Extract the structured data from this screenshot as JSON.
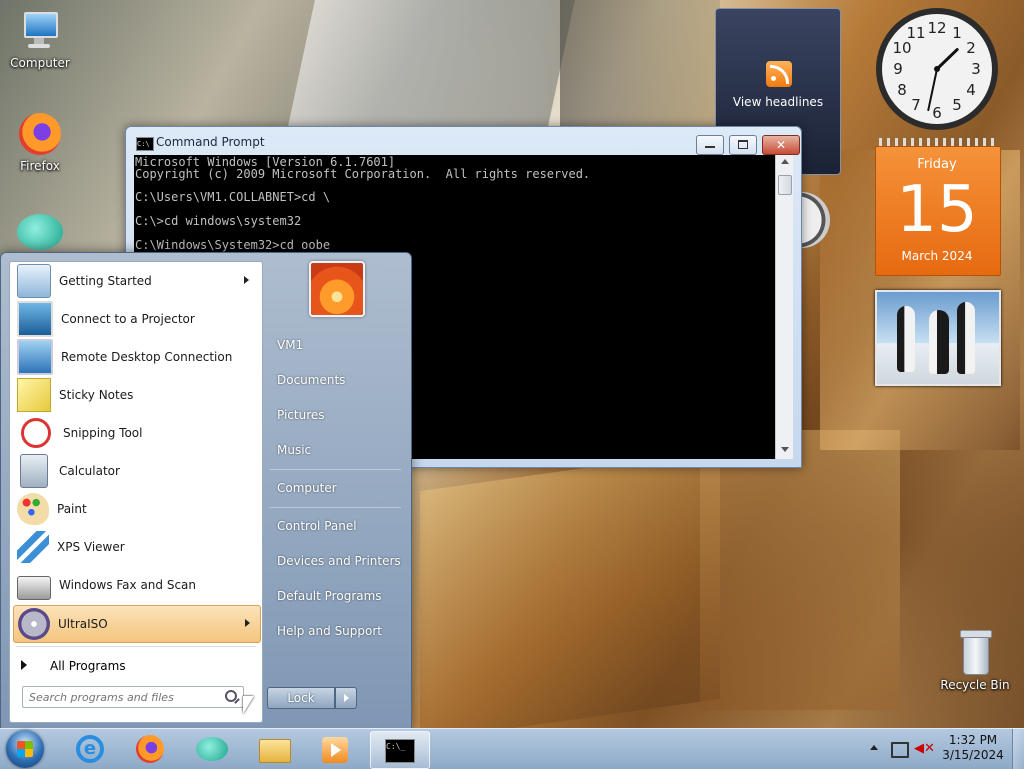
{
  "desktop": {
    "icons": [
      {
        "label": "Computer",
        "icon": "computer-icon"
      },
      {
        "label": "Firefox",
        "icon": "firefox-icon"
      },
      {
        "label": "Recycle Bin",
        "icon": "recycle-bin-icon"
      }
    ]
  },
  "cmd": {
    "title": "Command Prompt",
    "output": "Microsoft Windows [Version 6.1.7601]\nCopyright (c) 2009 Microsoft Corporation.  All rights reserved.\n\nC:\\Users\\VM1.COLLABNET>cd \\\n\nC:\\>cd windows\\system32\n\nC:\\Windows\\System32>cd oobe"
  },
  "gadgets": {
    "headlines": "View headlines",
    "calendar": {
      "weekday": "Friday",
      "day": "15",
      "month_year": "March 2024"
    },
    "clock": {
      "hour": 1,
      "minute": 32
    }
  },
  "start_menu": {
    "programs": [
      {
        "label": "Getting Started",
        "icon": "getting-started-icon",
        "submenu": true
      },
      {
        "label": "Connect to a Projector",
        "icon": "projector-icon"
      },
      {
        "label": "Remote Desktop Connection",
        "icon": "remote-desktop-icon"
      },
      {
        "label": "Sticky Notes",
        "icon": "sticky-notes-icon"
      },
      {
        "label": "Snipping Tool",
        "icon": "snipping-tool-icon"
      },
      {
        "label": "Calculator",
        "icon": "calculator-icon"
      },
      {
        "label": "Paint",
        "icon": "paint-icon"
      },
      {
        "label": "XPS Viewer",
        "icon": "xps-viewer-icon"
      },
      {
        "label": "Windows Fax and Scan",
        "icon": "fax-scan-icon"
      },
      {
        "label": "UltraISO",
        "icon": "ultraiso-icon",
        "submenu": true
      }
    ],
    "all_programs": "All Programs",
    "search_placeholder": "Search programs and files",
    "user": "VM1",
    "right_items": [
      "Documents",
      "Pictures",
      "Music",
      "Computer",
      "Control Panel",
      "Devices and Printers",
      "Default Programs",
      "Help and Support"
    ],
    "lock": "Lock"
  },
  "tray": {
    "time": "1:32 PM",
    "date": "3/15/2024"
  },
  "colors": {
    "accent": "#f5c57e",
    "calendar": "#f07c1d",
    "console_text": "#c0c0c0"
  }
}
